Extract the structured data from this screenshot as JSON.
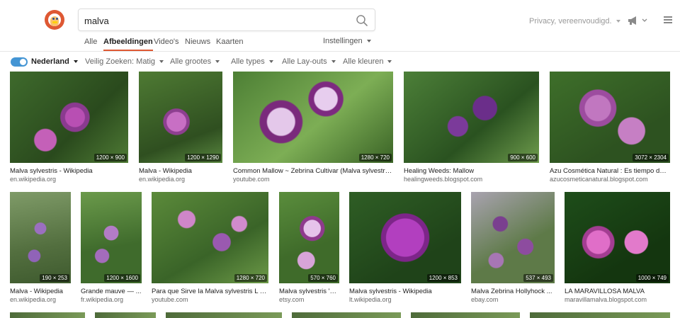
{
  "search": {
    "query": "malva"
  },
  "tabs": [
    {
      "label": "Alle",
      "active": false
    },
    {
      "label": "Afbeeldingen",
      "active": true
    },
    {
      "label": "Video's",
      "active": false
    },
    {
      "label": "Nieuws",
      "active": false
    },
    {
      "label": "Kaarten",
      "active": false
    }
  ],
  "settings_label": "Instellingen",
  "privacy_label": "Privacy, vereenvoudigd.",
  "filters": {
    "region": "Nederland",
    "region_toggle_on": true,
    "safe_search": "Veilig Zoeken: Matig",
    "size": "Alle grootes",
    "type": "Alle types",
    "layout": "Alle Lay-outs",
    "color": "Alle kleuren"
  },
  "results": [
    {
      "caption": "Malva sylvestris - Wikipedia",
      "source": "en.wikipedia.org",
      "dims": "1200 × 900"
    },
    {
      "caption": "Malva - Wikipedia",
      "source": "en.wikipedia.org",
      "dims": "1200 × 1290"
    },
    {
      "caption": "Common Mallow ~ Zebrina Cultivar (Malva sylvestris)...",
      "source": "youtube.com",
      "dims": "1280 × 720"
    },
    {
      "caption": "Healing Weeds: Mallow",
      "source": "healingweeds.blogspot.com",
      "dims": "900 × 600"
    },
    {
      "caption": "Azu Cosmética Natural : Es tiempo de ...",
      "source": "azucosmeticanatural.blogspot.com",
      "dims": "3072 × 2304"
    },
    {
      "caption": "Malva - Wikipedia",
      "source": "en.wikipedia.org",
      "dims": "190 × 253"
    },
    {
      "caption": "Grande mauve — ...",
      "source": "fr.wikipedia.org",
      "dims": "1200 × 1600"
    },
    {
      "caption": "Para que Sirve la Malva sylvestris L - Y...",
      "source": "youtube.com",
      "dims": "1280 × 720"
    },
    {
      "caption": "Malva sylvestris 'Z...",
      "source": "etsy.com",
      "dims": "570 × 760"
    },
    {
      "caption": "Malva sylvestris - Wikipedia",
      "source": "lt.wikipedia.org",
      "dims": "1200 × 853"
    },
    {
      "caption": "Malva Zebrina Hollyhock ...",
      "source": "ebay.com",
      "dims": "537 × 493"
    },
    {
      "caption": "LA MARAVILLOSA MALVA",
      "source": "maravillamalva.blogspot.com",
      "dims": "1000 × 749"
    }
  ],
  "colors": {
    "accent": "#de5833",
    "toggle": "#4495d4"
  },
  "icons": {
    "logo": "duck-logo",
    "search": "search-icon",
    "megaphone": "megaphone-icon",
    "menu": "hamburger-menu-icon"
  }
}
